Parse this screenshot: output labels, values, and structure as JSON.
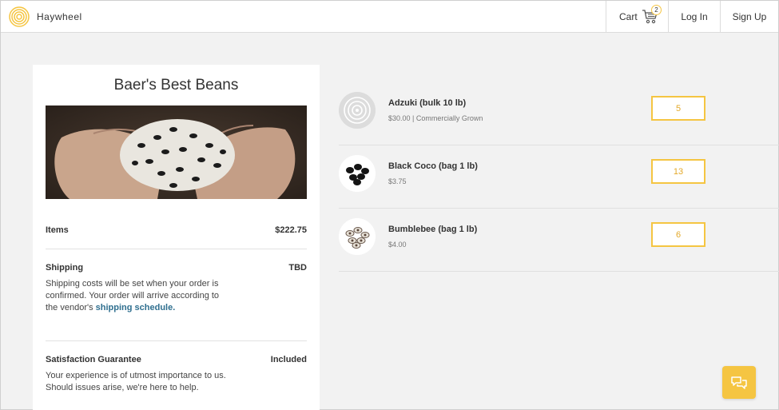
{
  "header": {
    "brand": "Haywheel",
    "nav": {
      "cart_label": "Cart",
      "cart_count": "2",
      "login_label": "Log In",
      "signup_label": "Sign Up"
    }
  },
  "vendor": {
    "title": "Baer's Best Beans"
  },
  "summary": {
    "items": {
      "label": "Items",
      "value": "$222.75"
    },
    "shipping": {
      "label": "Shipping",
      "value": "TBD",
      "text": "Shipping costs will be set when your order is confirmed. Your order will arrive according to the vendor's",
      "link_text": "shipping schedule."
    },
    "guarantee": {
      "label": "Satisfaction Guarantee",
      "value": "Included",
      "text": "Your experience is of utmost importance to us. Should issues arise, we're here to help."
    }
  },
  "products": [
    {
      "name": "Adzuki (bulk 10 lb)",
      "meta": "$30.00 | Commercially Grown",
      "qty": "5",
      "thumb": "placeholder-icon"
    },
    {
      "name": "Black Coco (bag 1 lb)",
      "meta": "$3.75",
      "qty": "13",
      "thumb": "black-beans-image"
    },
    {
      "name": "Bumblebee (bag 1 lb)",
      "meta": "$4.00",
      "qty": "6",
      "thumb": "bumblebee-beans-image"
    }
  ],
  "colors": {
    "accent": "#f5c542",
    "link": "#2f6f8f",
    "background": "#f2f2f2"
  }
}
